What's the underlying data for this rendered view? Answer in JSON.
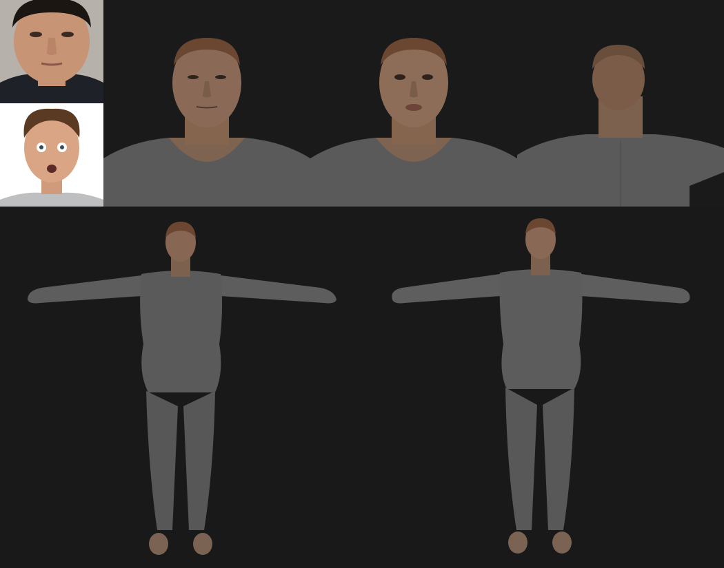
{
  "colors": {
    "background": "#191919",
    "skin": "#a07a62",
    "skin_dark": "#6f5442",
    "hair": "#6b4630",
    "garment": "#5a5a5a",
    "garment_shade": "#4a4a4a",
    "photo_top_bg": "#b3aea8",
    "photo_bottom_bg": "#ffffff"
  },
  "panels": [
    {
      "name": "input-photo-neutral",
      "kind": "photo"
    },
    {
      "name": "input-photo-surprised",
      "kind": "photo"
    },
    {
      "name": "avatar-head-front",
      "kind": "render"
    },
    {
      "name": "avatar-head-expression",
      "kind": "render"
    },
    {
      "name": "avatar-head-back",
      "kind": "render"
    },
    {
      "name": "avatar-full-body-a",
      "kind": "render"
    },
    {
      "name": "avatar-full-body-b",
      "kind": "render"
    }
  ]
}
